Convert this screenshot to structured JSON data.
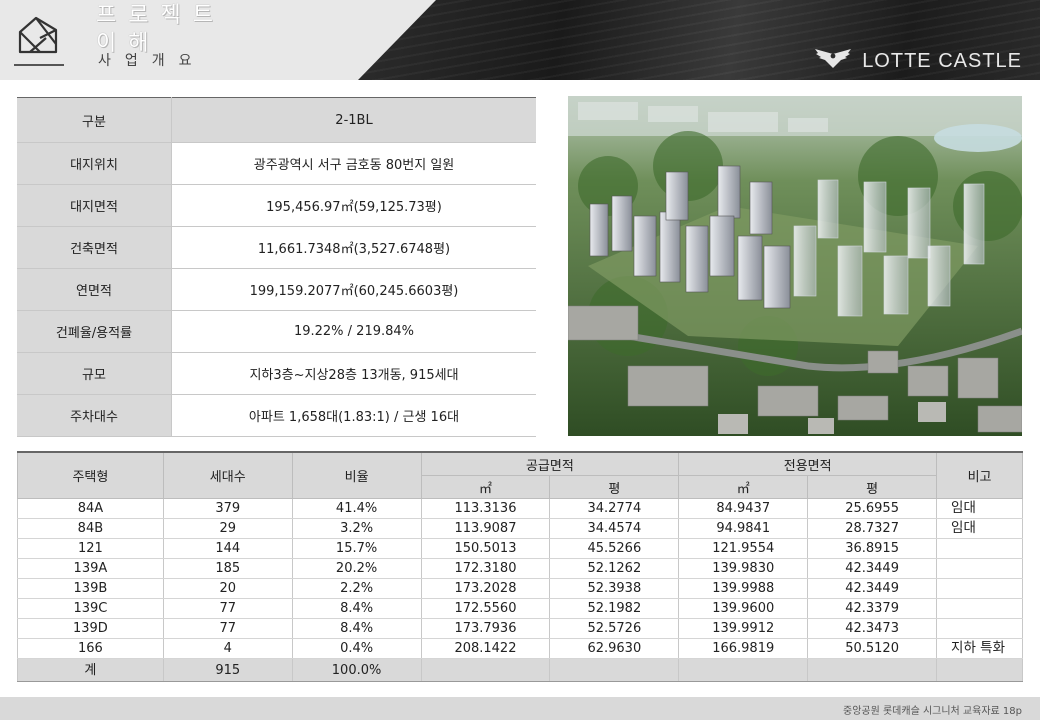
{
  "header": {
    "title": "프로젝트 이해",
    "subtitle": "사업개요",
    "brand": "LOTTE CASTLE",
    "logo_icon": "house-outline-icon",
    "brand_icon": "eagle-emblem-icon"
  },
  "summary": {
    "header": {
      "label": "구분",
      "value": "2-1BL"
    },
    "rows": [
      {
        "label": "대지위치",
        "value": "광주광역시 서구 금호동 80번지 일원"
      },
      {
        "label": "대지면적",
        "value": "195,456.97㎡(59,125.73평)"
      },
      {
        "label": "건축면적",
        "value": "11,661.7348㎡(3,527.6748평)"
      },
      {
        "label": "연면적",
        "value": "199,159.2077㎡(60,245.6603평)"
      },
      {
        "label": "건폐율/용적률",
        "value": "19.22% / 219.84%"
      },
      {
        "label": "규모",
        "value": "지하3층~지상28층 13개동, 915세대"
      },
      {
        "label": "주차대수",
        "value": "아파트 1,658대(1.83:1) / 근생 16대"
      }
    ]
  },
  "units": {
    "headers": {
      "type": "주택형",
      "count": "세대수",
      "ratio": "비율",
      "supply": "공급면적",
      "exclusive": "전용면적",
      "note": "비고",
      "m2": "㎡",
      "pyeong": "평"
    },
    "rows": [
      {
        "type": "84A",
        "count": "379",
        "ratio": "41.4%",
        "supply_m2": "113.3136",
        "supply_py": "34.2774",
        "excl_m2": "84.9437",
        "excl_py": "25.6955",
        "note": "임대"
      },
      {
        "type": "84B",
        "count": "29",
        "ratio": "3.2%",
        "supply_m2": "113.9087",
        "supply_py": "34.4574",
        "excl_m2": "94.9841",
        "excl_py": "28.7327",
        "note": "임대"
      },
      {
        "type": "121",
        "count": "144",
        "ratio": "15.7%",
        "supply_m2": "150.5013",
        "supply_py": "45.5266",
        "excl_m2": "121.9554",
        "excl_py": "36.8915",
        "note": ""
      },
      {
        "type": "139A",
        "count": "185",
        "ratio": "20.2%",
        "supply_m2": "172.3180",
        "supply_py": "52.1262",
        "excl_m2": "139.9830",
        "excl_py": "42.3449",
        "note": ""
      },
      {
        "type": "139B",
        "count": "20",
        "ratio": "2.2%",
        "supply_m2": "173.2028",
        "supply_py": "52.3938",
        "excl_m2": "139.9988",
        "excl_py": "42.3449",
        "note": ""
      },
      {
        "type": "139C",
        "count": "77",
        "ratio": "8.4%",
        "supply_m2": "172.5560",
        "supply_py": "52.1982",
        "excl_m2": "139.9600",
        "excl_py": "42.3379",
        "note": ""
      },
      {
        "type": "139D",
        "count": "77",
        "ratio": "8.4%",
        "supply_m2": "173.7936",
        "supply_py": "52.5726",
        "excl_m2": "139.9912",
        "excl_py": "42.3473",
        "note": ""
      },
      {
        "type": "166",
        "count": "4",
        "ratio": "0.4%",
        "supply_m2": "208.1422",
        "supply_py": "62.9630",
        "excl_m2": "166.9819",
        "excl_py": "50.5120",
        "note": "지하 특화"
      }
    ],
    "total": {
      "type": "계",
      "count": "915",
      "ratio": "100.0%"
    }
  },
  "footer": {
    "text": "중앙공원 롯데캐슬 시그니처 교육자료 18p"
  },
  "colors": {
    "header_gray": "#e8e8e8",
    "header_dark": "#1e1e1e",
    "cell_gray": "#d9d9d9"
  }
}
